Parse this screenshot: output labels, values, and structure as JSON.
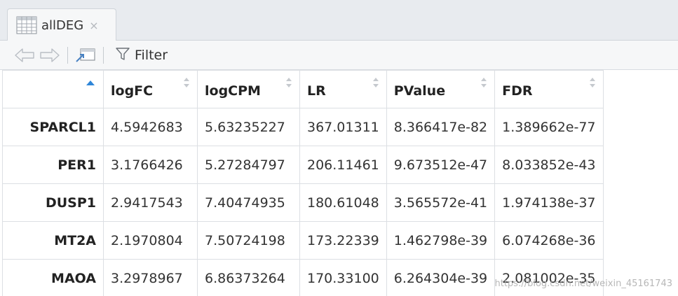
{
  "tab": {
    "title": "allDEG",
    "close_glyph": "×",
    "icon": "table-grid-icon"
  },
  "toolbar": {
    "back_icon": "arrow-left-icon",
    "forward_icon": "arrow-right-icon",
    "popout_icon": "popout-window-icon",
    "filter_icon": "filter-funnel-icon",
    "filter_label": "Filter"
  },
  "table": {
    "columns": [
      "logFC",
      "logCPM",
      "LR",
      "PValue",
      "FDR"
    ],
    "sorted_column_index": 0,
    "rows": [
      {
        "name": "SPARCL1",
        "cells": [
          "4.5942683",
          "5.63235227",
          "367.01311",
          "8.366417e-82",
          "1.389662e-77"
        ]
      },
      {
        "name": "PER1",
        "cells": [
          "3.1766426",
          "5.27284797",
          "206.11461",
          "9.673512e-47",
          "8.033852e-43"
        ]
      },
      {
        "name": "DUSP1",
        "cells": [
          "2.9417543",
          "7.40474935",
          "180.61048",
          "3.565572e-41",
          "1.974138e-37"
        ]
      },
      {
        "name": "MT2A",
        "cells": [
          "2.1970804",
          "7.50724198",
          "173.22339",
          "1.462798e-39",
          "6.074268e-36"
        ]
      },
      {
        "name": "MAOA",
        "cells": [
          "3.2978967",
          "6.86373264",
          "170.33100",
          "6.264304e-39",
          "2.081002e-35"
        ]
      }
    ]
  },
  "watermark": "https://blog.csdn.net/weixin_45161743",
  "colors": {
    "sort_active": "#2f86d8",
    "border": "#dcdfe3",
    "tabstrip_bg": "#e8ebef"
  }
}
